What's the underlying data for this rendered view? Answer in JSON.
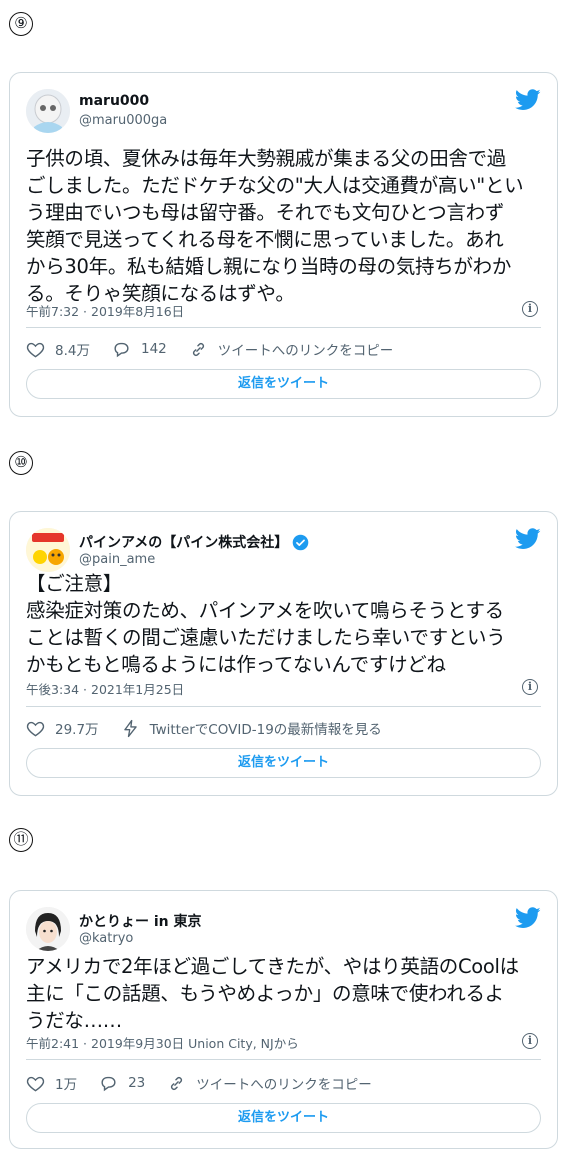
{
  "colors": {
    "accent": "#1d9bf0",
    "border": "#cfd9de",
    "muted": "#536471"
  },
  "tweets": [
    {
      "number": "⑨",
      "name": "maru000",
      "handle": "@maru000ga",
      "verified": false,
      "text": "子供の頃、夏休みは毎年大勢親戚が集まる父の田舎で過\nごしました。ただドケチな父の\"大人は交通費が高い\"とい\nう理由でいつも母は留守番。それでも文句ひとつ言わず\n笑顔で見送ってくれる母を不憫に思っていました。あれ\nから30年。私も結婚し親になり当時の母の気持ちがわか\nる。そりゃ笑顔になるはずや。",
      "timestamp": "午前7:32 · 2019年8月16日",
      "likes": "8.4万",
      "replies": "142",
      "link_label": "ツイートへのリンクをコピー",
      "reply_button": "返信をツイート"
    },
    {
      "number": "⑩",
      "name": "パインアメの【パイン株式会社】",
      "handle": "@pain_ame",
      "verified": true,
      "text": "【ご注意】\n感染症対策のため、パインアメを吹いて鳴らそうとする\nことは暫くの間ご遠慮いただけましたら幸いですという\nかもともと鳴るようには作ってないんですけどね",
      "timestamp": "午後3:34 · 2021年1月25日",
      "likes": "29.7万",
      "covid_label": "TwitterでCOVID-19の最新情報を見る",
      "reply_button": "返信をツイート"
    },
    {
      "number": "⑪",
      "name": "かとりょー in 東京",
      "handle": "@katryo",
      "verified": false,
      "text": "アメリカで2年ほど過ごしてきたが、やはり英語のCoolは\n主に「この話題、もうやめよっか」の意味で使われるよ\nうだな……",
      "timestamp": "午前2:41 · 2019年9月30日 Union City, NJから",
      "likes": "1万",
      "replies": "23",
      "link_label": "ツイートへのリンクをコピー",
      "reply_button": "返信をツイート"
    }
  ]
}
